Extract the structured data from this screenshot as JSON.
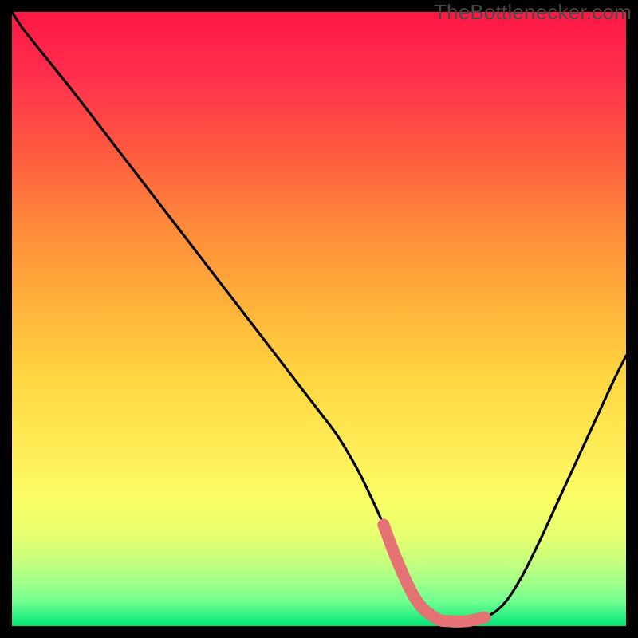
{
  "watermark": {
    "text": "TheBottlenecker.com"
  },
  "colors": {
    "frame": "#000000",
    "gradient_top": "#ff1744",
    "gradient_bottom": "#00e676",
    "curve": "#000000",
    "highlight": "#e57373"
  },
  "chart_data": {
    "type": "line",
    "title": "",
    "xlabel": "",
    "ylabel": "",
    "xlim": [
      0,
      100
    ],
    "ylim": [
      0,
      100
    ],
    "grid": false,
    "series": [
      {
        "name": "bottleneck-curve",
        "x": [
          0,
          2,
          6,
          10,
          15,
          20,
          25,
          30,
          35,
          40,
          45,
          50,
          53,
          56,
          58,
          60.5,
          63,
          66,
          69,
          71,
          74,
          77,
          80,
          83,
          86,
          89,
          92,
          95,
          98,
          100
        ],
        "y": [
          100,
          97,
          92,
          87,
          80.5,
          74,
          67.5,
          61,
          54.5,
          48,
          41.5,
          35,
          31,
          26,
          22,
          16.5,
          10,
          4,
          1.3,
          0.8,
          0.8,
          1.4,
          3.5,
          8,
          14,
          20.5,
          27,
          33.5,
          40,
          44
        ]
      },
      {
        "name": "optimal-range-highlight",
        "x": [
          60.5,
          63,
          66,
          69,
          71,
          74,
          77
        ],
        "y": [
          16.5,
          10,
          4,
          1.3,
          0.8,
          0.8,
          1.4
        ]
      }
    ]
  }
}
